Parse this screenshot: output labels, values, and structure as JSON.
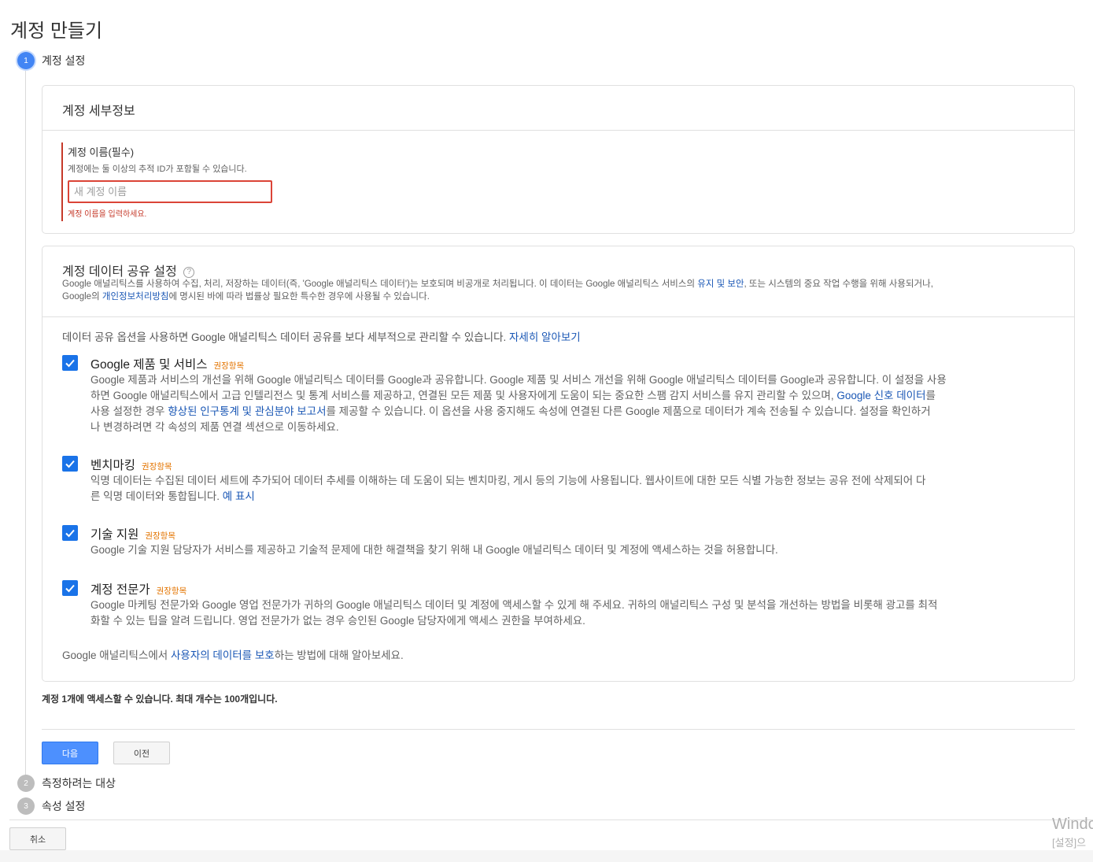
{
  "page": {
    "title": "계정 만들기"
  },
  "steps": [
    {
      "number": "1",
      "label": "계정 설정"
    },
    {
      "number": "2",
      "label": "측정하려는 대상"
    },
    {
      "number": "3",
      "label": "속성 설정"
    }
  ],
  "account_details": {
    "title": "계정 세부정보",
    "field_label": "계정 이름(필수)",
    "field_help": "계정에는 둘 이상의 추적 ID가 포함될 수 있습니다.",
    "input_placeholder": "새 계정 이름",
    "input_value": "",
    "error": "계정 이름을 입력하세요."
  },
  "data_sharing": {
    "title": "계정 데이터 공유 설정",
    "help_glyph": "?",
    "desc_line1_a": "Google 애널리틱스를 사용하여 수집, 처리, 저장하는 데이터(즉, 'Google 애널리틱스 데이터')는 보호되며 비공개로 처리됩니다. 이 데이터는 Google 애널리틱스 서비스의 ",
    "desc_link1": "유지 및 보안",
    "desc_line1_b": ", 또는 시스템의 중요 작업 수행을 위해 사용되거나,",
    "desc_line2_a": "Google의 ",
    "desc_link2": "개인정보처리방침",
    "desc_line2_b": "에 명시된 바에 따라 법률상 필요한 특수한 경우에 사용될 수 있습니다.",
    "intro_text": "데이터 공유 옵션을 사용하면 Google 애널리틱스 데이터 공유를 보다 세부적으로 관리할 수 있습니다. ",
    "intro_link": "자세히 알아보기",
    "recommended": "권장항목",
    "options": [
      {
        "title": "Google 제품 및 서비스",
        "checked": true,
        "line1": "Google 제품과 서비스의 개선을 위해 Google 애널리틱스 데이터를 Google과 공유합니다. Google 제품 및 서비스 개선을 위해 Google 애널리틱스 데이터를 Google과 공유합니다. 이 설정을 사용",
        "line2_a": "하면 Google 애널리틱스에서 고급 인텔리전스 및 통계 서비스를 제공하고, 연결된 모든 제품 및 사용자에게 도움이 되는 중요한 스팸 감지 서비스를 유지 관리할 수 있으며, ",
        "line2_link": "Google 신호 데이터",
        "line2_b": "를",
        "line3_a": "사용 설정한 경우 ",
        "line3_link": "향상된 인구통계 및 관심분야 보고서",
        "line3_b": "를 제공할 수 있습니다. 이 옵션을 사용 중지해도 속성에 연결된 다른 Google 제품으로 데이터가 계속 전송될 수 있습니다. 설정을 확인하거",
        "line4": "나 변경하려면 각 속성의 제품 연결 섹션으로 이동하세요."
      },
      {
        "title": "벤치마킹",
        "checked": true,
        "line1": "익명 데이터는 수집된 데이터 세트에 추가되어 데이터 추세를 이해하는 데 도움이 되는 벤치마킹, 게시 등의 기능에 사용됩니다. 웹사이트에 대한 모든 식별 가능한 정보는 공유 전에 삭제되어 다",
        "line2_a": "른 익명 데이터와 통합됩니다. ",
        "line2_link": "예 표시"
      },
      {
        "title": "기술 지원",
        "checked": true,
        "line1": "Google 기술 지원 담당자가 서비스를 제공하고 기술적 문제에 대한 해결책을 찾기 위해 내 Google 애널리틱스 데이터 및 계정에 액세스하는 것을 허용합니다."
      },
      {
        "title": "계정 전문가",
        "checked": true,
        "line1": "Google 마케팅 전문가와 Google 영업 전문가가 귀하의 Google 애널리틱스 데이터 및 계정에 액세스할 수 있게 해 주세요. 귀하의 애널리틱스 구성 및 분석을 개선하는 방법을 비롯해 광고를 최적",
        "line2": "화할 수 있는 팁을 알려 드립니다. 영업 전문가가 없는 경우 승인된 Google 담당자에게 액세스 권한을 부여하세요."
      }
    ],
    "learn_a": "Google 애널리틱스에서 ",
    "learn_link": "사용자의 데이터를 보호",
    "learn_b": "하는 방법에 대해 알아보세요."
  },
  "limit_note": "계정 1개에 액세스할 수 있습니다. 최대 개수는 100개입니다.",
  "buttons": {
    "next": "다음",
    "prev": "이전",
    "cancel": "취소"
  },
  "watermark": {
    "line1": "Windo",
    "line2": "[설정]으"
  },
  "colors": {
    "accent": "#4285f4",
    "error": "#c53929",
    "link": "#1a57b5",
    "recommended": "#e37400",
    "checkbox": "#1a73e8"
  }
}
